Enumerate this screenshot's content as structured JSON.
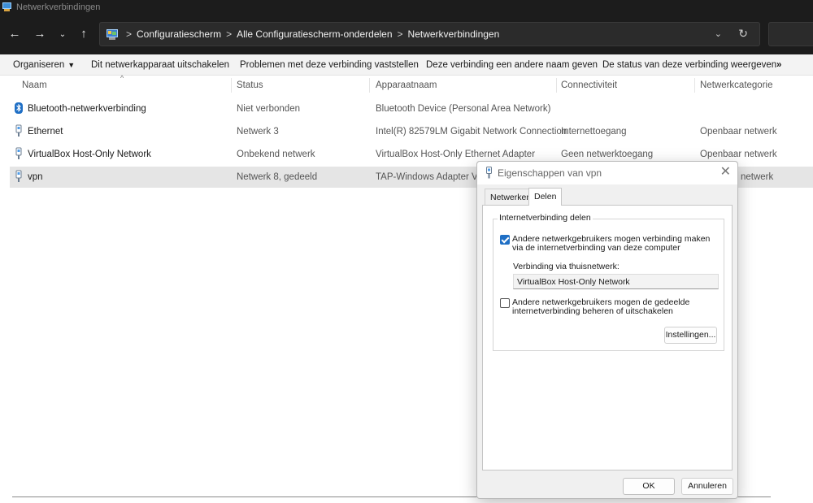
{
  "window": {
    "title": "Netwerkverbindingen"
  },
  "address": {
    "crumbs": [
      "Configuratiescherm",
      "Alle Configuratiescherm-onderdelen",
      "Netwerkverbindingen"
    ],
    "separator": ">"
  },
  "commands": {
    "organize": "Organiseren",
    "disable": "Dit netwerkapparaat uitschakelen",
    "diagnose": "Problemen met deze verbinding vaststellen",
    "rename": "Deze verbinding een andere naam geven",
    "status": "De status van deze verbinding weergeven",
    "more": "»"
  },
  "columns": {
    "name": "Naam",
    "status": "Status",
    "device": "Apparaatnaam",
    "connectivity": "Connectiviteit",
    "category": "Netwerkcategorie"
  },
  "rows": [
    {
      "name": "Bluetooth-netwerkverbinding",
      "status": "Niet verbonden",
      "device": "Bluetooth Device (Personal Area Network)",
      "connectivity": "",
      "category": ""
    },
    {
      "name": "Ethernet",
      "status": "Netwerk 3",
      "device": "Intel(R) 82579LM Gigabit Network Connection",
      "connectivity": "Internettoegang",
      "category": "Openbaar netwerk"
    },
    {
      "name": "VirtualBox Host-Only Network",
      "status": "Onbekend netwerk",
      "device": "VirtualBox Host-Only Ethernet Adapter",
      "connectivity": "Geen netwerktoegang",
      "category": "Openbaar netwerk"
    },
    {
      "name": "vpn",
      "status": "Netwerk 8, gedeeld",
      "device": "TAP-Windows Adapter V9",
      "connectivity": "",
      "category": "netwerk"
    }
  ],
  "dialog": {
    "title": "Eigenschappen van vpn",
    "tabs": [
      "Netwerken",
      "Delen"
    ],
    "group_title": "Internetverbinding delen",
    "allow_connect_label": "Andere netwerkgebruikers mogen verbinding maken via de internetverbinding van deze computer",
    "allow_connect_checked": true,
    "home_network_label": "Verbinding via thuisnetwerk:",
    "home_network_value": "VirtualBox Host-Only Network",
    "allow_control_label": "Andere netwerkgebruikers mogen de gedeelde internetverbinding beheren of uitschakelen",
    "allow_control_checked": false,
    "settings_button": "Instellingen...",
    "ok_button": "OK",
    "cancel_button": "Annuleren"
  },
  "colors": {
    "accent": "#1f6fc5",
    "titlebar": "#1c1c1c",
    "selected_row": "#e5e5e5"
  }
}
